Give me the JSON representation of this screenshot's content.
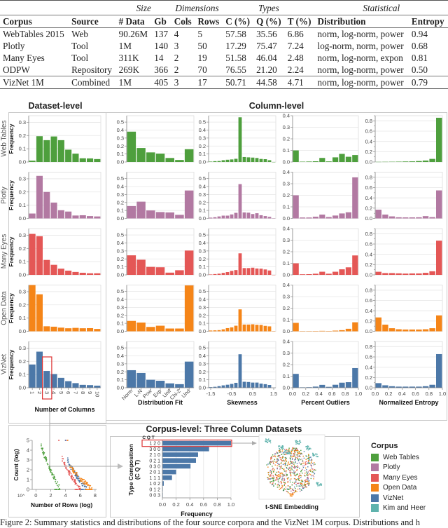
{
  "table": {
    "groups": [
      "Size",
      "Dimensions",
      "Types",
      "Statistical"
    ],
    "headers": [
      "Corpus",
      "Source",
      "# Data",
      "Gb",
      "Cols",
      "Rows",
      "C (%)",
      "Q (%)",
      "T (%)",
      "Distribution",
      "Entropy"
    ],
    "rows": [
      [
        "WebTables 2015",
        "Web",
        "90.26M",
        "137",
        "4",
        "5",
        "57.58",
        "35.56",
        "6.86",
        "norm, log-norm, power",
        "0.94"
      ],
      [
        "Plotly",
        "Tool",
        "1M",
        "140",
        "3",
        "50",
        "17.29",
        "75.47",
        "7.24",
        "log-norm, norm, power",
        "0.68"
      ],
      [
        "Many Eyes",
        "Tool",
        "311K",
        "14",
        "2",
        "19",
        "51.58",
        "46.04",
        "2.48",
        "norm, log-norm, expon",
        "0.81"
      ],
      [
        "ODPW",
        "Repository",
        "269K",
        "366",
        "2",
        "70",
        "76.55",
        "21.20",
        "2.24",
        "norm, log-norm, power",
        "0.50"
      ]
    ],
    "total_row": [
      "VizNet 1M",
      "Combined",
      "1M",
      "405",
      "3",
      "17",
      "50.71",
      "44.58",
      "4.71",
      "norm, log-norm, power",
      "0.79"
    ]
  },
  "sections": {
    "dataset_level": "Dataset-level",
    "column_level": "Column-level",
    "corpus_level": "Corpus-level: Three Column Datasets"
  },
  "colors": {
    "Web Tables": "#4e9f3d",
    "Plotly": "#b279a2",
    "Many Eyes": "#e45756",
    "Open Data": "#f58518",
    "VizNet": "#4c78a8",
    "Kim and Heer": "#5fb3ad"
  },
  "corpora": [
    "Web Tables",
    "Plotly",
    "Many Eyes",
    "Open Data",
    "VizNet"
  ],
  "chart_data": [
    {
      "id": "num-columns",
      "type": "bar",
      "title": "",
      "xlabel": "Number of Columns",
      "ylabel": "Frequency",
      "categories": [
        "1",
        "2",
        "3",
        "4",
        "5",
        "6",
        "7",
        "8",
        "9",
        "10"
      ],
      "ylim": [
        0,
        0.35
      ],
      "yticks": [
        0,
        0.1,
        0.2,
        0.3
      ],
      "highlight_category": "3",
      "series": [
        {
          "name": "Web Tables",
          "values": [
            0.01,
            0.195,
            0.165,
            0.193,
            0.165,
            0.093,
            0.063,
            0.028,
            0.027,
            0.022
          ]
        },
        {
          "name": "Plotly",
          "values": [
            0.037,
            0.322,
            0.2,
            0.12,
            0.062,
            0.052,
            0.022,
            0.024,
            0.018,
            0.015
          ]
        },
        {
          "name": "Many Eyes",
          "values": [
            0.31,
            0.292,
            0.113,
            0.076,
            0.047,
            0.032,
            0.022,
            0.016,
            0.012,
            0.012
          ]
        },
        {
          "name": "Open Data",
          "values": [
            0.35,
            0.28,
            0.038,
            0.035,
            0.028,
            0.023,
            0.026,
            0.023,
            0.024,
            0.018
          ]
        },
        {
          "name": "VizNet",
          "values": [
            0.176,
            0.273,
            0.127,
            0.104,
            0.075,
            0.05,
            0.035,
            0.022,
            0.02,
            0.016
          ]
        }
      ]
    },
    {
      "id": "distribution-fit",
      "type": "bar",
      "xlabel": "Distribution Fit",
      "ylabel": "",
      "categories": [
        "Norm",
        "L-N",
        "Pow",
        "Exp",
        "Unif",
        "Chi-2",
        "Und"
      ],
      "ylim": [
        0,
        0.58
      ],
      "yticks": [
        0,
        0.1,
        0.2,
        0.3,
        0.4,
        0.5
      ],
      "series": [
        {
          "name": "Web Tables",
          "values": [
            0.38,
            0.175,
            0.12,
            0.105,
            0.05,
            0.025,
            0.16
          ]
        },
        {
          "name": "Plotly",
          "values": [
            0.155,
            0.21,
            0.1,
            0.08,
            0.075,
            0.045,
            0.35
          ]
        },
        {
          "name": "Many Eyes",
          "values": [
            0.245,
            0.19,
            0.1,
            0.095,
            0.028,
            0.058,
            0.305
          ]
        },
        {
          "name": "Open Data",
          "values": [
            0.13,
            0.11,
            0.055,
            0.07,
            0.035,
            0.035,
            0.575
          ]
        },
        {
          "name": "VizNet",
          "values": [
            0.22,
            0.185,
            0.1,
            0.088,
            0.055,
            0.045,
            0.328
          ]
        }
      ]
    },
    {
      "id": "skewness",
      "type": "histogram",
      "xlabel": "Skewness",
      "ylabel": "",
      "xlim": [
        -1.6,
        1.6
      ],
      "xticks": [
        -1.5,
        -0.5,
        0.5,
        1.5
      ],
      "bins": 16,
      "ylim": [
        0,
        0.58
      ],
      "yticks": [
        0,
        0.1,
        0.2,
        0.3,
        0.4,
        0.5
      ],
      "series": [
        {
          "name": "Web Tables",
          "values": [
            0.005,
            0.01,
            0.012,
            0.022,
            0.028,
            0.032,
            0.04,
            0.56,
            0.062,
            0.058,
            0.055,
            0.05,
            0.038,
            0.035,
            0.022,
            0.0
          ]
        },
        {
          "name": "Plotly",
          "values": [
            0.01,
            0.015,
            0.025,
            0.035,
            0.035,
            0.05,
            0.07,
            0.43,
            0.075,
            0.072,
            0.055,
            0.065,
            0.04,
            0.03,
            0.02,
            0.0
          ]
        },
        {
          "name": "Many Eyes",
          "values": [
            0.005,
            0.01,
            0.015,
            0.025,
            0.035,
            0.05,
            0.06,
            0.27,
            0.085,
            0.085,
            0.09,
            0.08,
            0.078,
            0.068,
            0.055,
            0.0
          ]
        },
        {
          "name": "Open Data",
          "values": [
            0.01,
            0.012,
            0.015,
            0.025,
            0.04,
            0.05,
            0.07,
            0.275,
            0.085,
            0.085,
            0.088,
            0.082,
            0.08,
            0.068,
            0.062,
            0.0
          ]
        },
        {
          "name": "VizNet",
          "values": [
            0.008,
            0.012,
            0.02,
            0.03,
            0.038,
            0.048,
            0.062,
            0.42,
            0.075,
            0.072,
            0.065,
            0.065,
            0.052,
            0.045,
            0.035,
            0.0
          ]
        }
      ]
    },
    {
      "id": "percent-outliers",
      "type": "histogram",
      "xlabel": "Percent Outliers",
      "ylabel": "",
      "xlim": [
        0,
        1
      ],
      "xticks": [
        0.0,
        0.2,
        0.4,
        0.6,
        0.8,
        1.0
      ],
      "bins": 10,
      "ylim": [
        0,
        0.4
      ],
      "yticks": [
        0,
        0.1,
        0.2,
        0.3,
        0.4
      ],
      "series": [
        {
          "name": "Web Tables",
          "values": [
            0.1,
            0.003,
            0.004,
            0.006,
            0.035,
            0.005,
            0.04,
            0.07,
            0.045,
            0.06
          ]
        },
        {
          "name": "Plotly",
          "values": [
            0.2,
            0.008,
            0.008,
            0.015,
            0.033,
            0.012,
            0.025,
            0.043,
            0.053,
            0.355
          ]
        },
        {
          "name": "Many Eyes",
          "values": [
            0.1,
            0.005,
            0.006,
            0.01,
            0.027,
            0.01,
            0.027,
            0.048,
            0.065,
            0.168
          ]
        },
        {
          "name": "Open Data",
          "values": [
            0.073,
            0.002,
            0.002,
            0.003,
            0.004,
            0.003,
            0.006,
            0.01,
            0.022,
            0.078
          ]
        },
        {
          "name": "VizNet",
          "values": [
            0.12,
            0.004,
            0.005,
            0.01,
            0.025,
            0.008,
            0.026,
            0.044,
            0.048,
            0.17
          ]
        }
      ]
    },
    {
      "id": "normalized-entropy",
      "type": "histogram",
      "xlabel": "Normalized Entropy",
      "ylabel": "",
      "xlim": [
        0,
        1
      ],
      "xticks": [
        0.0,
        0.2,
        0.4,
        0.6,
        0.8,
        1.0
      ],
      "bins": 10,
      "ylim": [
        0,
        0.9
      ],
      "yticks": [
        0,
        0.2,
        0.4,
        0.6,
        0.8
      ],
      "series": [
        {
          "name": "Web Tables",
          "values": [
            0.003,
            0.004,
            0.005,
            0.007,
            0.01,
            0.012,
            0.018,
            0.028,
            0.06,
            0.86
          ]
        },
        {
          "name": "Plotly",
          "values": [
            0.17,
            0.075,
            0.04,
            0.022,
            0.02,
            0.02,
            0.022,
            0.045,
            0.025,
            0.545
          ]
        },
        {
          "name": "Many Eyes",
          "values": [
            0.06,
            0.035,
            0.035,
            0.03,
            0.025,
            0.028,
            0.028,
            0.04,
            0.07,
            0.665
          ]
        },
        {
          "name": "Open Data",
          "values": [
            0.27,
            0.13,
            0.06,
            0.04,
            0.035,
            0.035,
            0.035,
            0.04,
            0.06,
            0.31
          ]
        },
        {
          "name": "VizNet",
          "values": [
            0.09,
            0.048,
            0.03,
            0.022,
            0.022,
            0.022,
            0.022,
            0.03,
            0.058,
            0.655
          ]
        }
      ]
    },
    {
      "id": "rows-scatter",
      "type": "scatter",
      "xlabel": "Number of Rows (log)",
      "ylabel": "Count (log)",
      "xlim": [
        -0.5,
        8.2
      ],
      "ylim": [
        0,
        5
      ],
      "xticks": [
        0,
        2,
        4,
        6,
        8
      ],
      "yticks": [
        0,
        1,
        2,
        3,
        4,
        5
      ],
      "x_prefix_label": "10^",
      "clusters": [
        {
          "name": "Web Tables",
          "x_start": 0.7,
          "x_end": 3.3,
          "y_top": 4.6
        },
        {
          "name": "Many Eyes",
          "x_start": 3.5,
          "x_end": 6.0,
          "y_top": 3.3
        },
        {
          "name": "VizNet",
          "x_start": 4.3,
          "x_end": 6.9,
          "y_top": 3.0
        },
        {
          "name": "Open Data",
          "x_start": 4.6,
          "x_end": 7.6,
          "y_top": 2.5
        }
      ]
    },
    {
      "id": "type-composition",
      "type": "bar",
      "orientation": "horizontal",
      "xlabel": "Frequency",
      "ylabel": "Type Composition (C Q T)",
      "column_header": "C Q T",
      "categories": [
        "1 2 0",
        "3 0 0",
        "2 1 0",
        "0 2 1",
        "0 3 0",
        "2 0 1",
        "1 1 1",
        "1 0 2",
        "0 1 2",
        "0 0 3"
      ],
      "values": [
        1.0,
        0.68,
        0.52,
        0.49,
        0.41,
        0.2,
        0.14,
        0.02,
        0.005,
        0.003
      ],
      "xlim": [
        0,
        1
      ],
      "xticks": [
        0.0,
        0.2,
        0.4,
        0.6,
        0.8,
        1.0
      ],
      "highlight_category": "1 2 0"
    },
    {
      "id": "tsne",
      "type": "scatter",
      "xlabel": "t-SNE Embedding",
      "series_names": [
        "Web Tables",
        "Plotly",
        "Many Eyes",
        "Open Data",
        "VizNet",
        "Kim and Heer"
      ]
    }
  ],
  "legend": {
    "title": "Corpus",
    "items": [
      "Web Tables",
      "Plotly",
      "Many Eyes",
      "Open Data",
      "VizNet",
      "Kim and Heer"
    ]
  },
  "caption": "Figure 2: Summary statistics and distributions of the four source corpora and the VizNet 1M corpus. Distributions and h"
}
